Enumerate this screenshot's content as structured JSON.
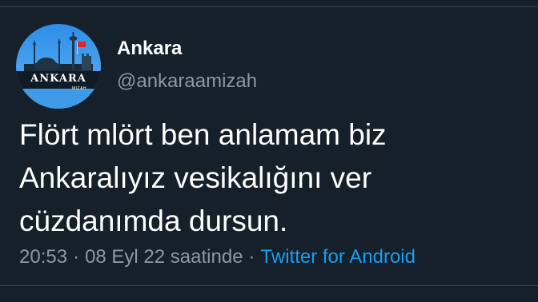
{
  "tweet": {
    "display_name": "Ankara",
    "handle": "@ankaraamizah",
    "avatar": {
      "text": "ANKARA",
      "subtext": "MIZAH",
      "icon": "ankara-skyline-avatar"
    },
    "text": "Flört mlört ben anlamam biz Ankaralıyız vesikalığını ver cüzdanımda dursun.",
    "time": "20:53",
    "separator": "·",
    "date": "08 Eyl 22 saatinde",
    "source": "Twitter for Android"
  },
  "colors": {
    "background": "#15202b",
    "secondary_text": "#8b98a5",
    "link": "#1d9bf0",
    "divider": "#38444d"
  }
}
